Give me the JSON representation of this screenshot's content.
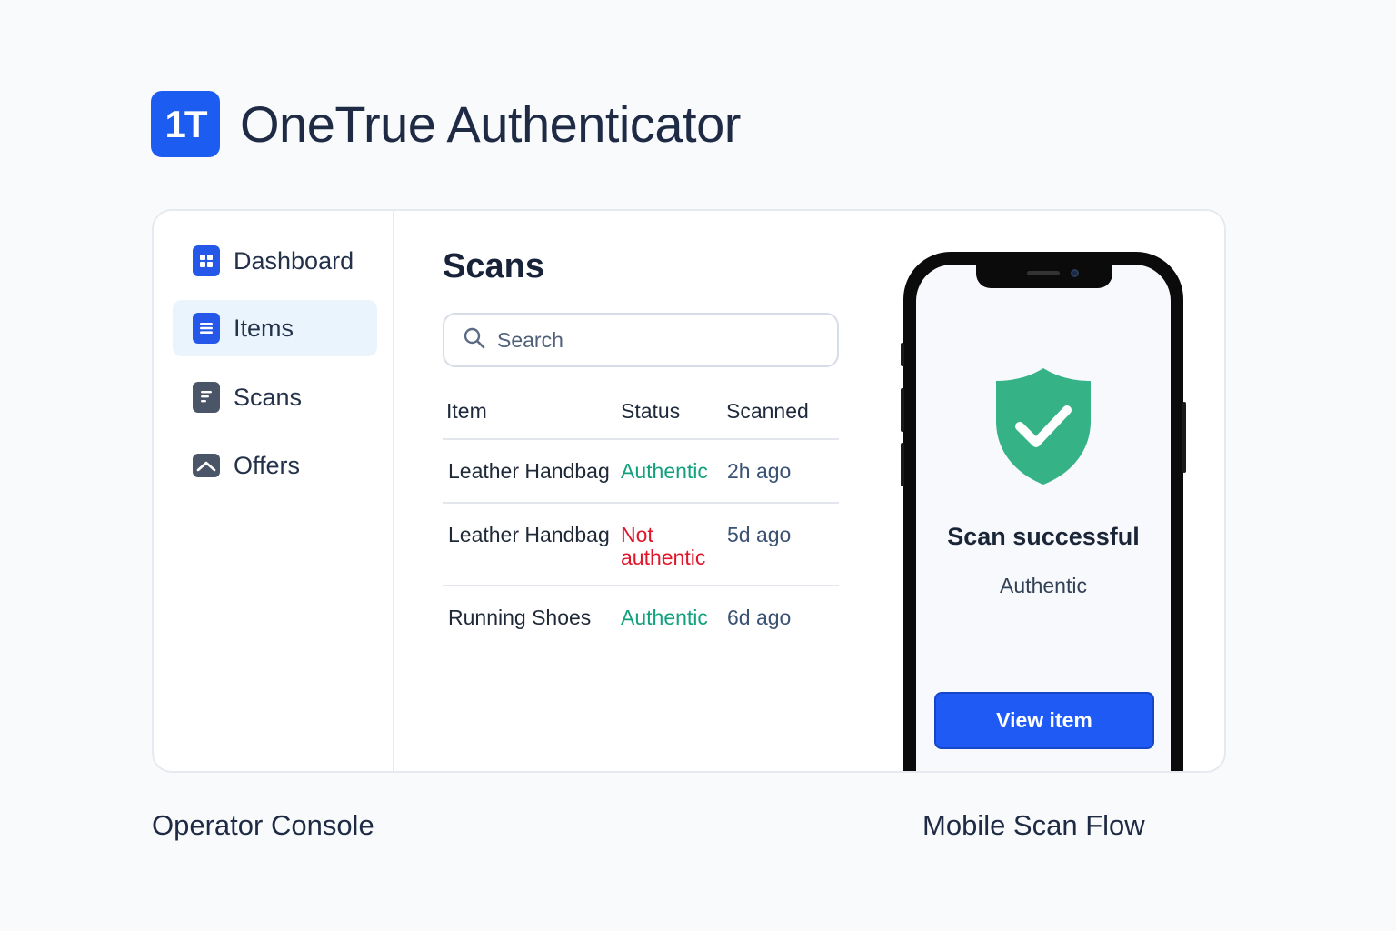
{
  "brand": {
    "logo_text": "1T",
    "title": "OneTrue Authenticator"
  },
  "sidebar": {
    "items": [
      {
        "label": "Dashboard",
        "icon": "grid-icon",
        "active": false
      },
      {
        "label": "Items",
        "icon": "list-icon",
        "active": true
      },
      {
        "label": "Scans",
        "icon": "document-icon",
        "active": false
      },
      {
        "label": "Offers",
        "icon": "image-icon",
        "active": false
      }
    ]
  },
  "main": {
    "title": "Scans",
    "search": {
      "placeholder": "Search",
      "value": ""
    },
    "table": {
      "headers": [
        "Item",
        "Status",
        "Scanned"
      ],
      "rows": [
        {
          "item": "Leather Handbag",
          "status": "Authentic",
          "status_type": "authentic",
          "scanned": "2h ago"
        },
        {
          "item": "Leather Handbag",
          "status": "Not authentic",
          "status_type": "not-authentic",
          "scanned": "5d ago"
        },
        {
          "item": "Running Shoes",
          "status": "Authentic",
          "status_type": "authentic",
          "scanned": "6d ago"
        }
      ]
    }
  },
  "phone": {
    "icon": "shield-check-icon",
    "title": "Scan successful",
    "subtitle": "Authentic",
    "button_label": "View item"
  },
  "captions": {
    "left": "Operator Console",
    "right": "Mobile Scan Flow"
  },
  "colors": {
    "accent": "#1d5cf0",
    "authentic": "#12a07d",
    "not_authentic": "#e0162b",
    "shield": "#36b287"
  }
}
